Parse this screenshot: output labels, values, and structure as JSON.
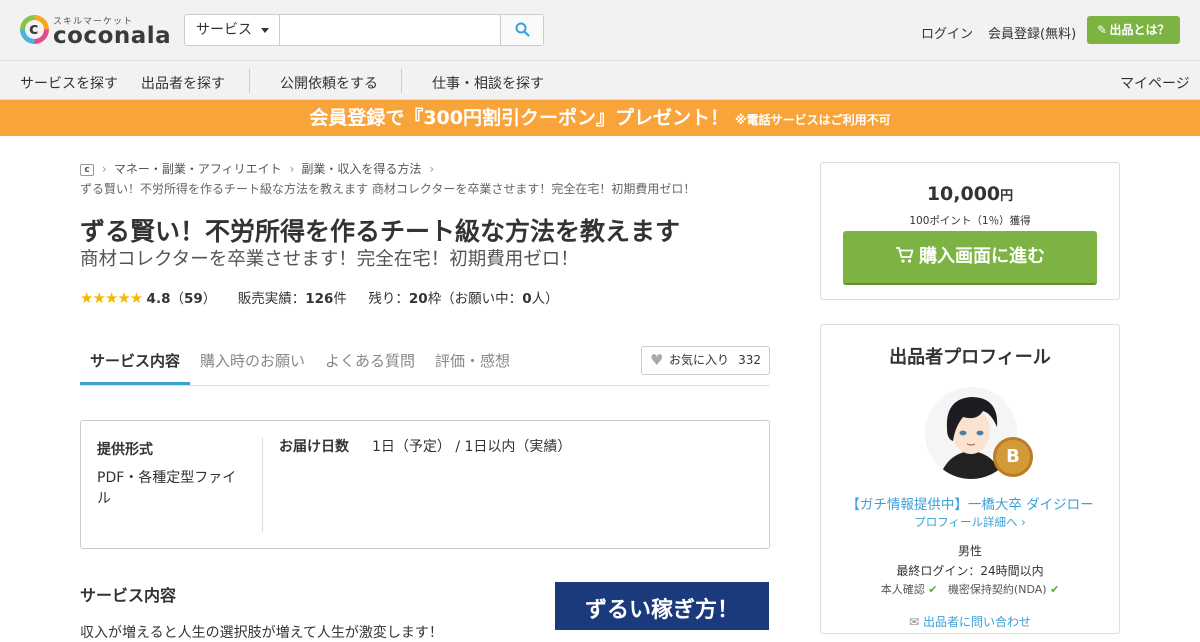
{
  "header": {
    "logo_small": "スキルマーケット",
    "logo_word": "coconala",
    "search_category": "サービス",
    "search_placeholder": "",
    "login": "ログイン",
    "register": "会員登録(無料)",
    "sell_button": "出品とは？"
  },
  "nav": {
    "items": [
      "サービスを探す",
      "出品者を探す",
      "公開依頼をする",
      "仕事・相談を探す"
    ],
    "mypage": "マイページ"
  },
  "banner": {
    "main": "会員登録で『300円割引クーポン』プレゼント！",
    "note": "※電話サービスはご利用不可"
  },
  "breadcrumb": {
    "items": [
      "マネー・副業・アフィリエイト",
      "副業・収入を得る方法"
    ],
    "current": "ずる賢い！不労所得を作るチート級な方法を教えます 商材コレクターを卒業させます！完全在宅！初期費用ゼロ！"
  },
  "service": {
    "title": "ずる賢い！不労所得を作るチート級な方法を教えます",
    "subtitle": "商材コレクターを卒業させます！完全在宅！初期費用ゼロ！",
    "stars": "★★★★★",
    "rating": "4.8",
    "review_count": "59",
    "sales_label": "販売実績：",
    "sales": "126",
    "sales_unit": "件",
    "remaining_label": "残り：",
    "remaining": "20",
    "remaining_unit": "枠（お願い中：",
    "requesting": "0",
    "requesting_unit": "人）"
  },
  "tabs": [
    {
      "label": "サービス内容",
      "active": true
    },
    {
      "label": "購入時のお願い",
      "active": false
    },
    {
      "label": "よくある質問",
      "active": false
    },
    {
      "label": "評価・感想",
      "active": false
    }
  ],
  "favorite": {
    "label": "お気に入り",
    "count": "332"
  },
  "info": {
    "format_label": "提供形式",
    "format_value": "PDF・各種定型ファイル",
    "delivery_label": "お届け日数",
    "delivery_value": "1日（予定） / 1日以内（実績）"
  },
  "content": {
    "heading": "サービス内容",
    "text": "収入が増えると人生の選択肢が増えて人生が激変します！",
    "promo_text": "ずるい稼ぎ方！"
  },
  "purchase": {
    "price": "10,000",
    "price_unit": "円",
    "points": "100ポイント（1％）獲得",
    "buy_button": "購入画面に進む"
  },
  "profile": {
    "title": "出品者プロフィール",
    "badge": "B",
    "seller_name": "【ガチ情報提供中】一橋大卒 ダイジロー",
    "detail_link": "プロフィール詳細へ",
    "gender": "男性",
    "last_login": "最終ログイン：24時間以内",
    "identity": "本人確認",
    "nda": "機密保持契約(NDA)",
    "contact": "出品者に問い合わせ"
  },
  "colors": {
    "accent_green": "#7cb342",
    "banner_orange": "#f9a43a",
    "link_blue": "#3aa0d8",
    "star_yellow": "#f5b800"
  }
}
